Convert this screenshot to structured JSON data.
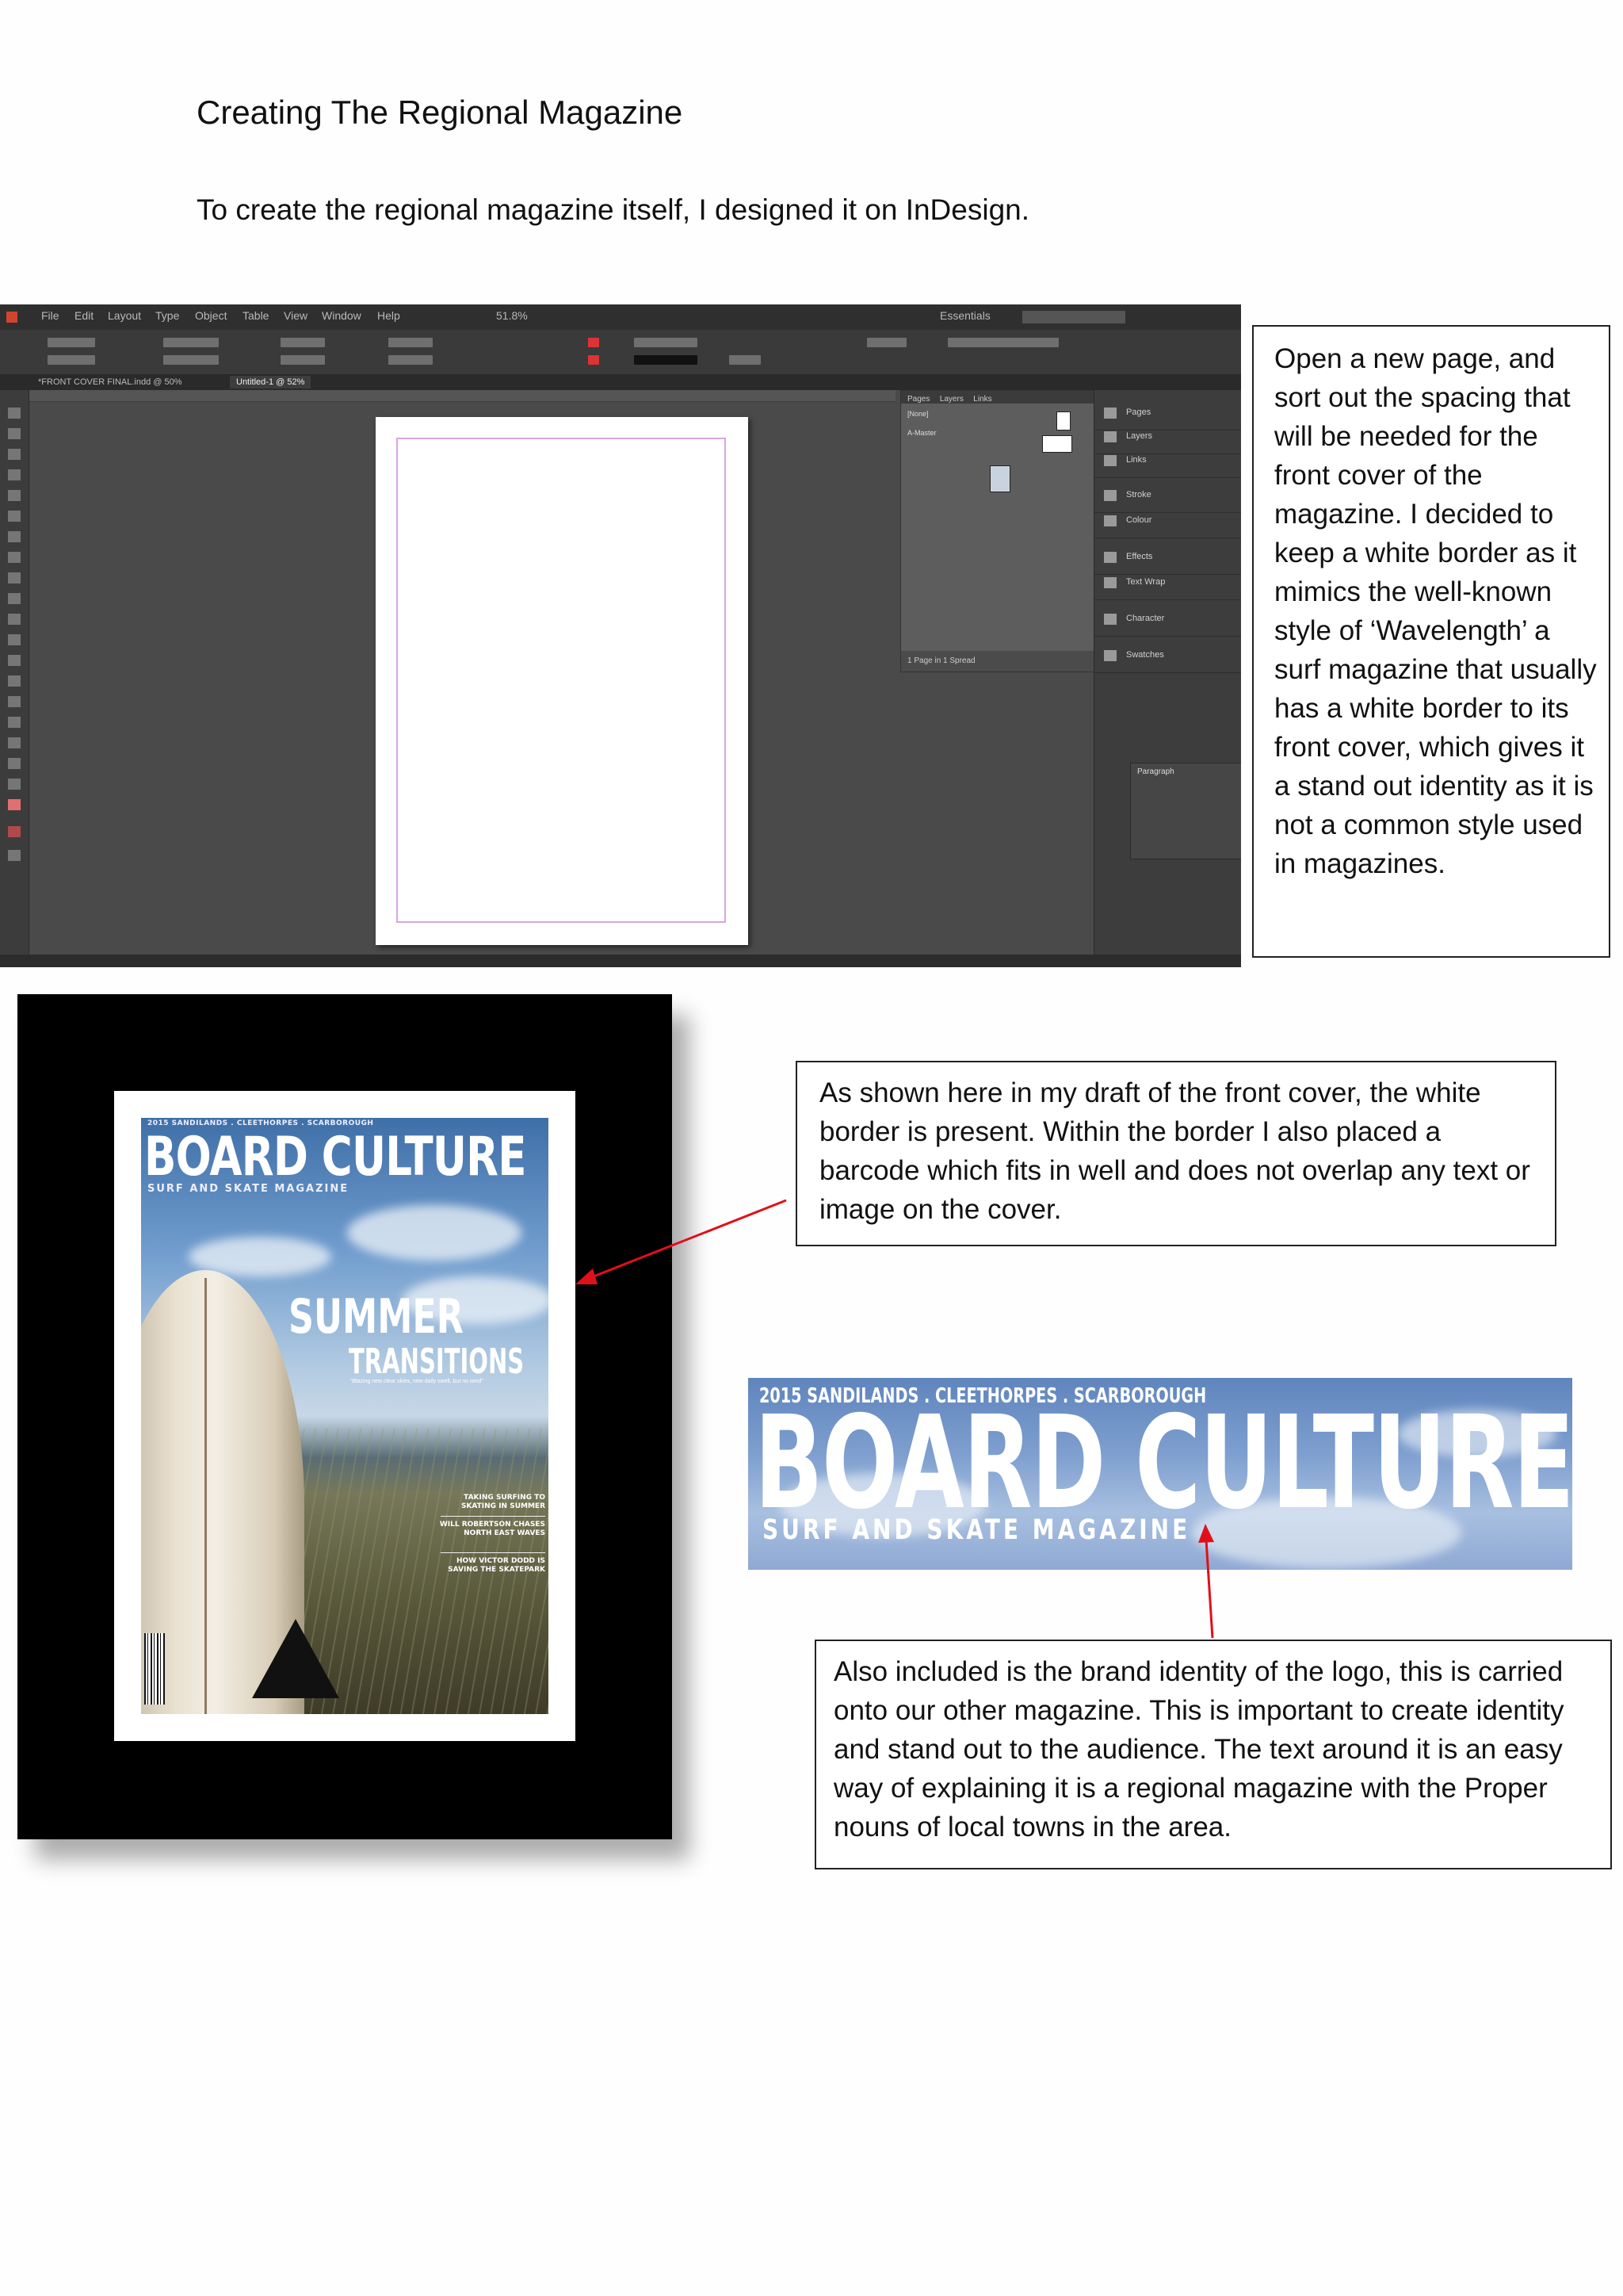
{
  "document": {
    "title": "Creating The Regional Magazine",
    "intro": "To create the regional magazine itself, I designed it on InDesign."
  },
  "indesign": {
    "menu": [
      "File",
      "Edit",
      "Layout",
      "Type",
      "Object",
      "Table",
      "View",
      "Window",
      "Help"
    ],
    "zoom": "51.8%",
    "workspace": "Essentials",
    "tabs": [
      "*FRONT COVER FINAL.indd @ 50%",
      "Untitled-1 @ 52%"
    ],
    "pages_panel_tabs": [
      "Pages",
      "Layers",
      "Links"
    ],
    "pages_panel_items": [
      "[None]",
      "A-Master"
    ],
    "pages_panel_footer": "1 Page in 1 Spread",
    "dock_items": [
      "Pages",
      "Layers",
      "Links",
      "Stroke",
      "Colour",
      "Effects",
      "Text Wrap",
      "Character",
      "Swatches"
    ],
    "paragraph_panel": "Paragraph"
  },
  "callouts": {
    "one": "Open a new page, and sort out the spacing that will be needed for the front cover of the magazine. I decided to keep a white border as it mimics the well-known style of ‘Wavelength’ a surf magazine that usually has a white border to its front cover, which gives it a stand out identity as it is not a common style used in magazines.",
    "two": "As shown here in my draft of the front cover, the white border is present. Within the border I also placed a barcode which fits in well and does not overlap any text or image on the cover.",
    "three": "Also included is the brand identity of the logo, this is carried onto our other magazine. This is important to create identity and stand out to the audience. The text around it is an easy way of explaining it is a regional magazine with the Proper nouns of local towns in the area."
  },
  "cover": {
    "towns": "2015 SANDILANDS . CLEETHORPES . SCARBOROUGH",
    "masthead": "BOARD CULTURE",
    "subtitle": "SURF AND SKATE MAGAZINE",
    "headline_1": "SUMMER",
    "headline_2": "TRANSITIONS",
    "tagline": "“Blazing new clear skies, new daily swell, but no wind”",
    "stories": [
      "TAKING SURFING TO SKATING IN SUMMER",
      "WILL ROBERTSON CHASES NORTH EAST WAVES",
      "HOW VICTOR DODD IS SAVING THE SKATEPARK"
    ]
  },
  "banner": {
    "towns": "2015 SANDILANDS . CLEETHORPES . SCARBOROUGH",
    "masthead": "BOARD CULTURE",
    "subtitle": "SURF AND SKATE MAGAZINE"
  },
  "colors": {
    "arrow": "#e0101a",
    "indesign_bg": "#4a4a4a",
    "margin_guide": "#d6a6e3"
  }
}
